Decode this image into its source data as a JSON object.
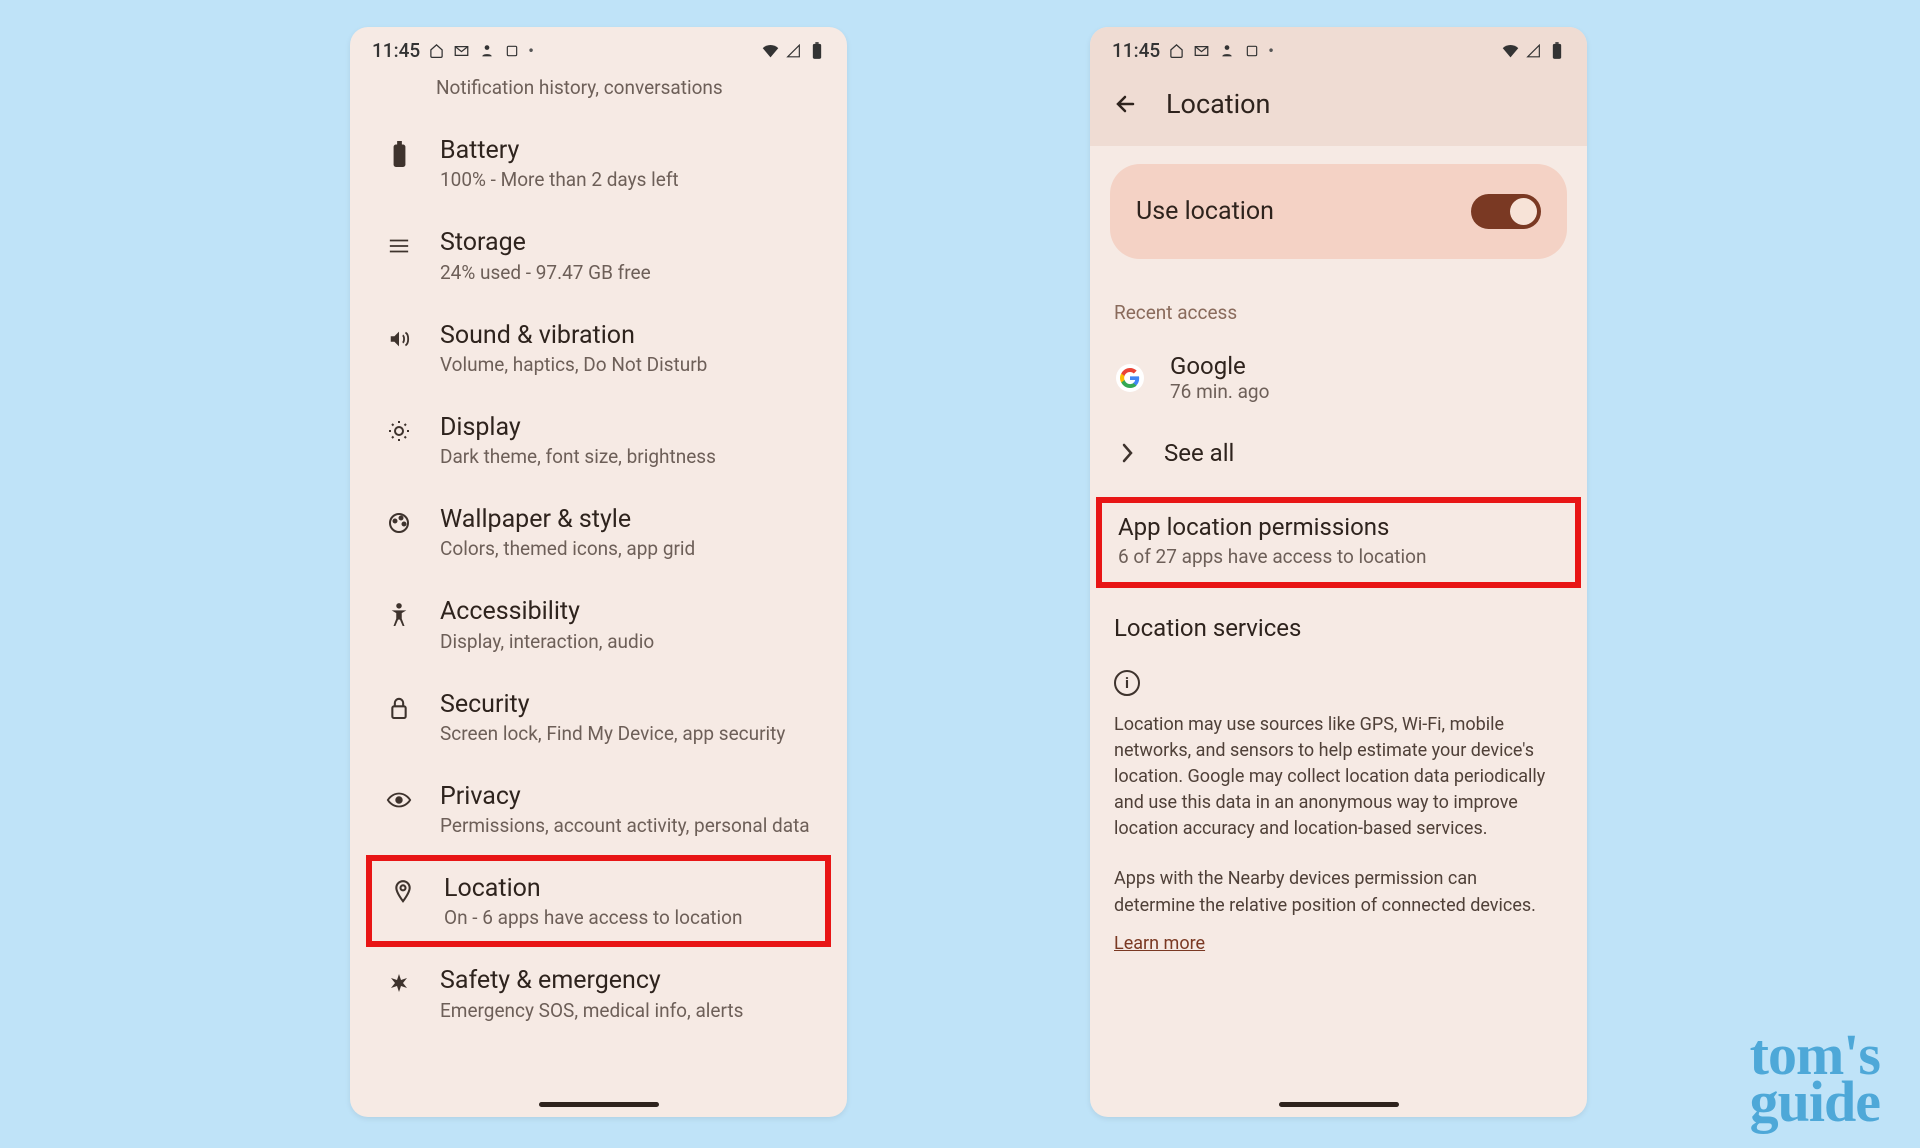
{
  "status": {
    "time": "11:45",
    "notif_icons": [
      "home-icon",
      "gmail-icon",
      "person-icon",
      "box-icon"
    ],
    "right_icons": [
      "wifi-icon",
      "signal-icon",
      "battery-icon"
    ]
  },
  "left": {
    "partial_subtitle": "Notification history, conversations",
    "items": [
      {
        "icon": "battery-icon",
        "title": "Battery",
        "subtitle": "100% - More than 2 days left"
      },
      {
        "icon": "storage-icon",
        "title": "Storage",
        "subtitle": "24% used - 97.47 GB free"
      },
      {
        "icon": "sound-icon",
        "title": "Sound & vibration",
        "subtitle": "Volume, haptics, Do Not Disturb"
      },
      {
        "icon": "display-icon",
        "title": "Display",
        "subtitle": "Dark theme, font size, brightness"
      },
      {
        "icon": "wallpaper-icon",
        "title": "Wallpaper & style",
        "subtitle": "Colors, themed icons, app grid"
      },
      {
        "icon": "accessibility-icon",
        "title": "Accessibility",
        "subtitle": "Display, interaction, audio"
      },
      {
        "icon": "security-icon",
        "title": "Security",
        "subtitle": "Screen lock, Find My Device, app security"
      },
      {
        "icon": "privacy-icon",
        "title": "Privacy",
        "subtitle": "Permissions, account activity, personal data"
      },
      {
        "icon": "location-icon",
        "title": "Location",
        "subtitle": "On - 6 apps have access to location"
      },
      {
        "icon": "emergency-icon",
        "title": "Safety & emergency",
        "subtitle": "Emergency SOS, medical info, alerts"
      }
    ]
  },
  "right": {
    "header_title": "Location",
    "use_location_label": "Use location",
    "use_location_on": true,
    "recent_access_label": "Recent access",
    "recent": {
      "app": "Google",
      "time": "76 min. ago"
    },
    "see_all_label": "See all",
    "app_perm": {
      "title": "App location permissions",
      "subtitle": "6 of 27 apps have access to location"
    },
    "loc_services_title": "Location services",
    "info_para1": "Location may use sources like GPS, Wi-Fi, mobile networks, and sensors to help estimate your device's location. Google may collect location data periodically and use this data in an anonymous way to improve location accuracy and location-based services.",
    "info_para2": "Apps with the Nearby devices permission can determine the relative position of connected devices.",
    "learn_more": "Learn more"
  },
  "watermark": {
    "line1": "tom's",
    "line2": "guide"
  }
}
